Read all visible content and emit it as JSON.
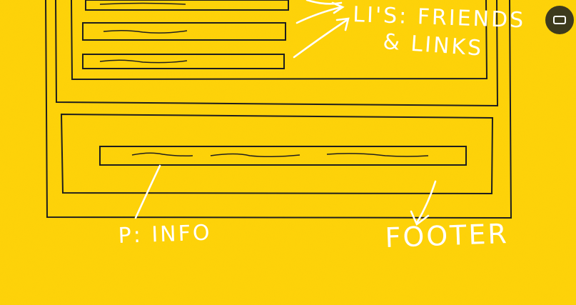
{
  "sketch": {
    "label_list": "LI'S: FRIENDS",
    "label_list_line2": "& LINKS",
    "label_paragraph": "P: INFO",
    "label_footer": "FOOTER"
  },
  "controls": {
    "fullscreen_icon": "fullscreen-icon"
  },
  "colors": {
    "background": "#ffd20a",
    "ink": "#1e1e1e",
    "chalk": "#ffffff",
    "button": "#3d3a1d"
  }
}
